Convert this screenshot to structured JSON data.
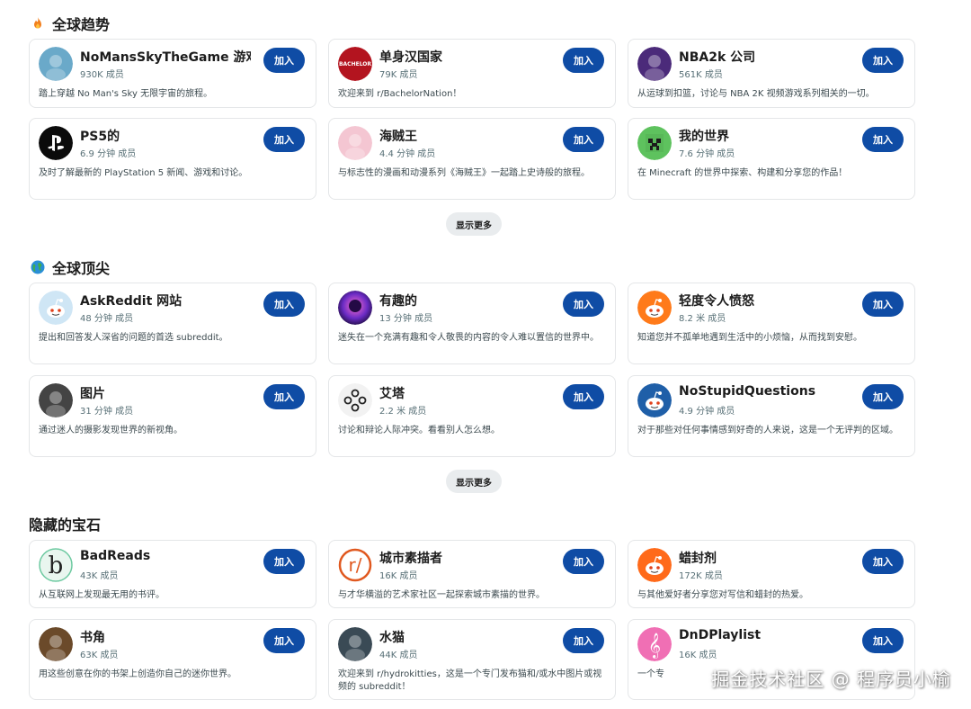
{
  "sections": [
    {
      "title": "全球趋势",
      "icon": "fire-icon",
      "show_more": "显示更多",
      "cards": [
        {
          "name": "NoMansSkyTheGame 游戏",
          "members": "930K 成员",
          "desc": "踏上穿越 No Man's Sky 无限宇宙的旅程。",
          "join": "加入",
          "icon": "nomanssky-avatar-icon",
          "color": "#6aa9c9"
        },
        {
          "name": "单身汉国家",
          "members": "79K 成员",
          "desc": "欢迎来到 r/BachelorNation！",
          "join": "加入",
          "icon": "bachelor-avatar-icon",
          "color": "#b3141f"
        },
        {
          "name": "NBA2k 公司",
          "members": "561K 成员",
          "desc": "从运球到扣篮，讨论与 NBA 2K 视频游戏系列相关的一切。",
          "join": "加入",
          "icon": "nba2k-avatar-icon",
          "color": "#4b2a7a"
        },
        {
          "name": "PS5的",
          "members": "6.9 分钟 成员",
          "desc": "及时了解最新的 PlayStation 5 新闻、游戏和讨论。",
          "join": "加入",
          "icon": "playstation-avatar-icon",
          "color": "#0b0b0b"
        },
        {
          "name": "海贼王",
          "members": "4.4 分钟 成员",
          "desc": "与标志性的漫画和动漫系列《海贼王》一起踏上史诗般的旅程。",
          "join": "加入",
          "icon": "onepiece-avatar-icon",
          "color": "#f4c6d2"
        },
        {
          "name": "我的世界",
          "members": "7.6 分钟 成员",
          "desc": "在 Minecraft 的世界中探索、构建和分享您的作品！",
          "join": "加入",
          "icon": "minecraft-avatar-icon",
          "color": "#5ec25e"
        }
      ]
    },
    {
      "title": "全球顶尖",
      "icon": "globe-icon",
      "show_more": "显示更多",
      "cards": [
        {
          "name": "AskReddit 网站",
          "members": "48 分钟 成员",
          "desc": "提出和回答发人深省的问题的首选 subreddit。",
          "join": "加入",
          "icon": "askreddit-avatar-icon",
          "color": "#cfe6f5"
        },
        {
          "name": "有趣的",
          "members": "13 分钟 成员",
          "desc": "迷失在一个充满有趣和令人敬畏的内容的令人难以置信的世界中。",
          "join": "加入",
          "icon": "interesting-avatar-icon",
          "color": "#7a2fb8"
        },
        {
          "name": "轻度令人愤怒",
          "members": "8.2 米 成员",
          "desc": "知道您并不孤单地遇到生活中的小烦恼，从而找到安慰。",
          "join": "加入",
          "icon": "snoo-avatar-icon",
          "color": "#ff7a1a"
        },
        {
          "name": "图片",
          "members": "31 分钟 成员",
          "desc": "通过迷人的摄影发现世界的新视角。",
          "join": "加入",
          "icon": "pics-avatar-icon",
          "color": "#444444"
        },
        {
          "name": "艾塔",
          "members": "2.2 米 成员",
          "desc": "讨论和辩论人际冲突。看看别人怎么想。",
          "join": "加入",
          "icon": "aita-avatar-icon",
          "color": "#f2f2f2"
        },
        {
          "name": "NoStupidQuestions",
          "members": "4.9 分钟 成员",
          "desc": "对于那些对任何事情感到好奇的人来说，这是一个无评判的区域。",
          "join": "加入",
          "icon": "nostupid-avatar-icon",
          "color": "#1f5fa8"
        }
      ]
    },
    {
      "title": "隐藏的宝石",
      "icon": "",
      "cards": [
        {
          "name": "BadReads",
          "members": "43K 成员",
          "desc": "从互联网上发现最无用的书评。",
          "join": "加入",
          "icon": "badreads-avatar-icon",
          "color": "#e9f6ef"
        },
        {
          "name": "城市素描者",
          "members": "16K 成员",
          "desc": "与才华横溢的艺术家社区一起探索城市素描的世界。",
          "join": "加入",
          "icon": "urbansketch-avatar-icon",
          "color": "#ffffff"
        },
        {
          "name": "蜡封剂",
          "members": "172K 成员",
          "desc": "与其他爱好者分享您对写信和蜡封的热爱。",
          "join": "加入",
          "icon": "waxseal-avatar-icon",
          "color": "#ff6a1a"
        },
        {
          "name": "书角",
          "members": "63K 成员",
          "desc": "用这些创意在你的书架上创造你自己的迷你世界。",
          "join": "加入",
          "icon": "booknook-avatar-icon",
          "color": "#6b4a2a"
        },
        {
          "name": "水猫",
          "members": "44K 成员",
          "desc": "欢迎来到 r/hydrokitties，这是一个专门发布猫和/或水中图片或视频的 subreddit！",
          "join": "加入",
          "icon": "hydrokitty-avatar-icon",
          "color": "#3a4a55"
        },
        {
          "name": "DnDPlaylist",
          "members": "16K 成员",
          "desc": "一个专",
          "join": "加入",
          "icon": "music-note-avatar-icon",
          "color": "#f06fb4"
        }
      ]
    }
  ],
  "watermark": "掘金技术社区 @ 程序员小榆"
}
